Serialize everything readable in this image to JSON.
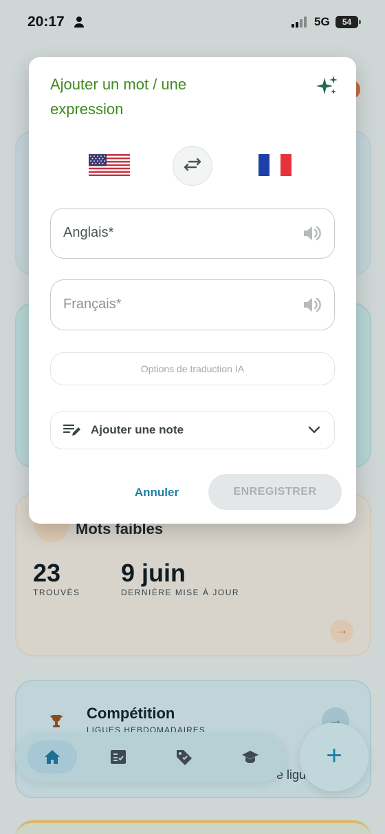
{
  "status_bar": {
    "time": "20:17",
    "network": "5G",
    "battery": "54",
    "icons": [
      "person-icon",
      "signal-icon",
      "battery-icon"
    ]
  },
  "background": {
    "weak_words": {
      "title": "Mots faibles",
      "found_value": "23",
      "found_label": "TROUVÉS",
      "date_value": "9 juin",
      "date_label": "DERNIÈRE MISE À JOUR",
      "arrow": "→"
    },
    "competition": {
      "title": "Compétition",
      "subtitle": "LIGUES HEBDOMADAIRES",
      "partial_text": "e ligu",
      "arrow": "→"
    },
    "nav": {
      "items": [
        "home-icon",
        "checklist-icon",
        "tag-icon",
        "graduation-cap-icon"
      ],
      "fab_label": "+"
    }
  },
  "dialog": {
    "title": "Ajouter un mot / une expression",
    "source_language_flag": "us-flag",
    "target_language_flag": "fr-flag",
    "english_field": {
      "placeholder": "Anglais*"
    },
    "french_field": {
      "placeholder": "Français*"
    },
    "ai_options_label": "Options de traduction IA",
    "note_label": "Ajouter une note",
    "cancel_label": "Annuler",
    "save_label": "ENREGISTRER"
  },
  "colors": {
    "title_green": "#3f8a1e",
    "accent_blue": "#1d7ea8",
    "sparkle_green": "#1f6b4f"
  }
}
